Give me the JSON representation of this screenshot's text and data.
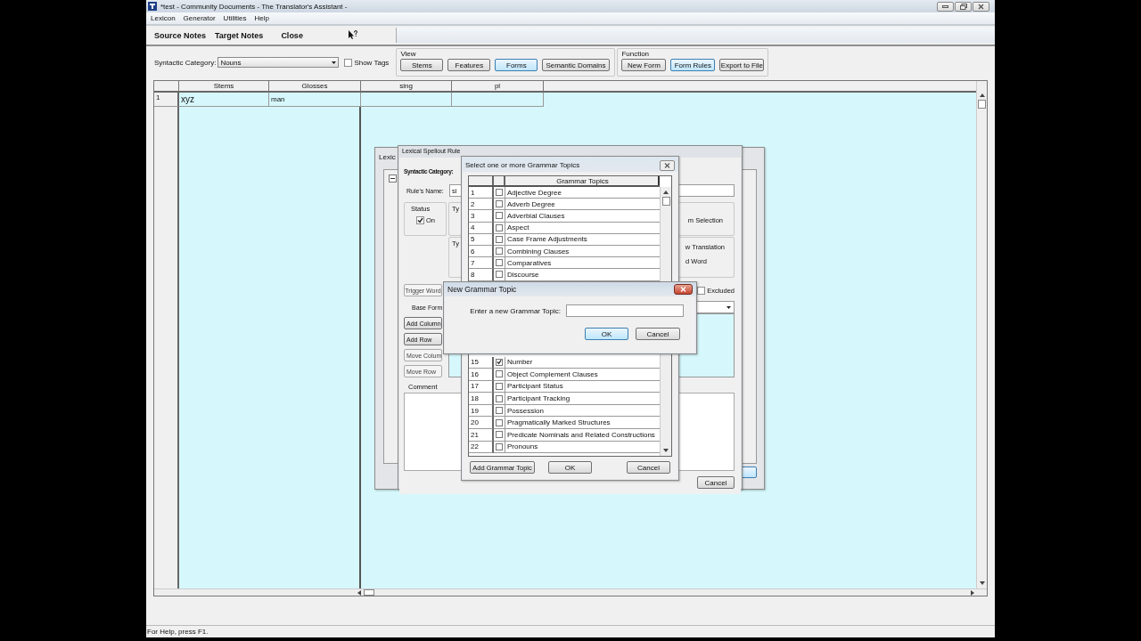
{
  "window": {
    "title": "*test - Community Documents - The Translator's Assistant -"
  },
  "menu": [
    "Lexicon",
    "Generator",
    "Utilities",
    "Help"
  ],
  "toolbar": [
    "Source Notes",
    "Target Notes",
    "Close"
  ],
  "filter": {
    "label": "Syntactic Category:",
    "value": "Nouns"
  },
  "show_tags": {
    "label": "Show Tags",
    "checked": false
  },
  "view": {
    "label": "View",
    "buttons": [
      {
        "label": "Stems",
        "selected": false
      },
      {
        "label": "Features",
        "selected": false
      },
      {
        "label": "Forms",
        "selected": true
      },
      {
        "label": "Semantic Domains",
        "selected": false
      }
    ]
  },
  "function": {
    "label": "Function",
    "buttons": [
      {
        "label": "New Form",
        "selected": false
      },
      {
        "label": "Form Rules",
        "selected": true
      },
      {
        "label": "Export to File",
        "selected": false
      }
    ]
  },
  "table": {
    "columns": [
      "Stems",
      "Glosses",
      "sing",
      "pl"
    ],
    "rows": [
      {
        "number": "1",
        "cells": [
          "xyz",
          "man"
        ]
      }
    ]
  },
  "back_dialog": {
    "title": "Lexic"
  },
  "rule_dialog": {
    "title": "Lexical Spellout Rule",
    "category_label": "Syntactic Category:",
    "name_label": "Rule's Name:",
    "name_value": "si",
    "status": {
      "label": "Status",
      "option": "On",
      "checked": true
    },
    "type_labels": [
      "Ty",
      "Ty"
    ],
    "type_texts": [
      "m Selection",
      "w Translation",
      "d Word"
    ],
    "trigger_button": "Trigger Word",
    "excluded": {
      "label": "Excluded",
      "checked": false
    },
    "base_form_label": "Base Form",
    "row_buttons": [
      {
        "label": "Add Column",
        "disabled": false
      },
      {
        "label": "Add Row",
        "disabled": false
      },
      {
        "label": "Move Colum",
        "disabled": true
      },
      {
        "label": "Move Row",
        "disabled": true
      }
    ],
    "comment_label": "Comment",
    "cancel_button": "Cancel"
  },
  "topics_dialog": {
    "title": "Select one or more Grammar Topics",
    "column": "Grammar Topics",
    "rows_top": [
      {
        "number": "1",
        "label": "Adjective Degree",
        "checked": false
      },
      {
        "number": "2",
        "label": "Adverb Degree",
        "checked": false
      },
      {
        "number": "3",
        "label": "Adverbial Clauses",
        "checked": false
      },
      {
        "number": "4",
        "label": "Aspect",
        "checked": false
      },
      {
        "number": "5",
        "label": "Case Frame Adjustments",
        "checked": false
      },
      {
        "number": "6",
        "label": "Combining Clauses",
        "checked": false
      },
      {
        "number": "7",
        "label": "Comparatives",
        "checked": false
      },
      {
        "number": "8",
        "label": "Discourse",
        "checked": false
      }
    ],
    "rows_bottom": [
      {
        "number": "15",
        "label": "Number",
        "checked": true
      },
      {
        "number": "16",
        "label": "Object Complement Clauses",
        "checked": false
      },
      {
        "number": "17",
        "label": "Participant Status",
        "checked": false
      },
      {
        "number": "18",
        "label": "Participant Tracking",
        "checked": false
      },
      {
        "number": "19",
        "label": "Possession",
        "checked": false
      },
      {
        "number": "20",
        "label": "Pragmatically Marked Structures",
        "checked": false
      },
      {
        "number": "21",
        "label": "Predicate Nominals and Related Constructions",
        "checked": false
      },
      {
        "number": "22",
        "label": "Pronouns",
        "checked": false
      }
    ],
    "buttons": [
      "Add Grammar Topic",
      "OK",
      "Cancel"
    ]
  },
  "prompt_dialog": {
    "title": "New Grammar Topic",
    "prompt": "Enter a new Grammar Topic:",
    "buttons": [
      "OK",
      "Cancel"
    ]
  },
  "status_bar": "For Help, press F1."
}
